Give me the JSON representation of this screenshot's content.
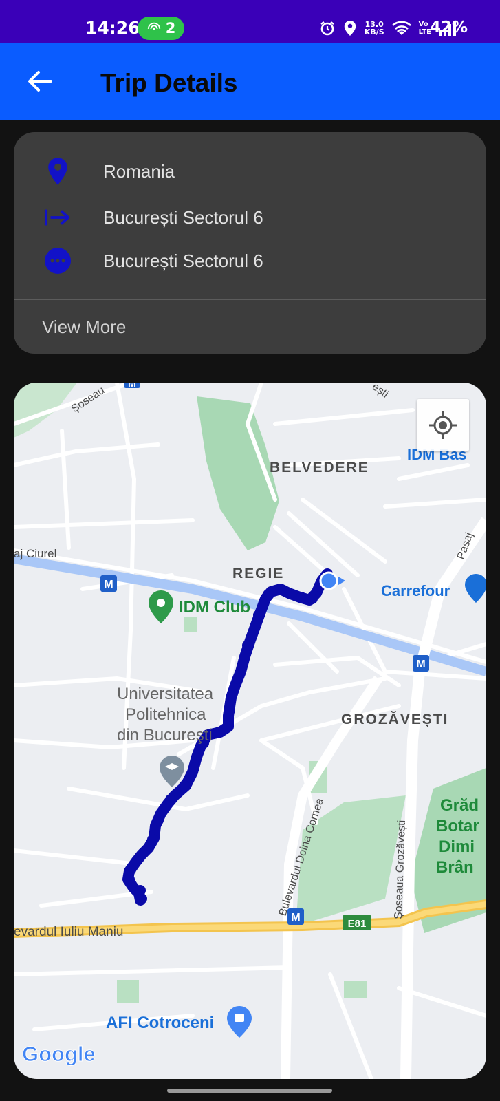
{
  "status_bar": {
    "time": "14:26",
    "hotspot_count": "2",
    "net_speed_value": "13.0",
    "net_speed_unit": "KB/S",
    "volte_top": "Vo",
    "volte_bottom": "LTE",
    "battery": "42%"
  },
  "app_bar": {
    "title": "Trip Details"
  },
  "trip_card": {
    "rows": [
      {
        "icon": "location-pin-icon",
        "text": "Romania"
      },
      {
        "icon": "arrow-right-to-line-icon",
        "text": "București Sectorul 6"
      },
      {
        "icon": "more-horizontal-circle-icon",
        "text": "București Sectorul 6"
      }
    ],
    "view_more": "View More"
  },
  "map": {
    "labels": {
      "belvedere": "BELVEDERE",
      "regie": "REGIE",
      "grozavesti": "GROZĂVEȘTI",
      "idm_club": "IDM Club",
      "idm_bas": "IDM Bas",
      "carrefour": "Carrefour",
      "univ_1": "Universitatea",
      "univ_2": "Politehnica",
      "univ_3": "din Bucureşti",
      "afi": "AFI Cotroceni",
      "gradina_1": "Grăd",
      "gradina_2": "Botar",
      "gradina_3": "Dimi",
      "gradina_4": "Brân",
      "bd_iuliu_maniu": "evardul Iuliu Maniu",
      "e81": "E81",
      "bd_doina_cornea": "Bulevardul Doina Cornea",
      "sos_grozavesti": "Șoseaua Grozăvești",
      "aj_ciurel": "aj Ciurel",
      "soseau": "Șoseau",
      "pasaj": "Pasaj",
      "top_right_street": "ești",
      "metro": "M",
      "google": "Google"
    },
    "route_color": "#0a0aa8",
    "current_location_color": "#4285f4"
  },
  "colors": {
    "status_bar": "#3a00b8",
    "app_bar": "#0a5cff",
    "background": "#121212",
    "card": "#3d3d3d",
    "icon": "#1212c8"
  }
}
